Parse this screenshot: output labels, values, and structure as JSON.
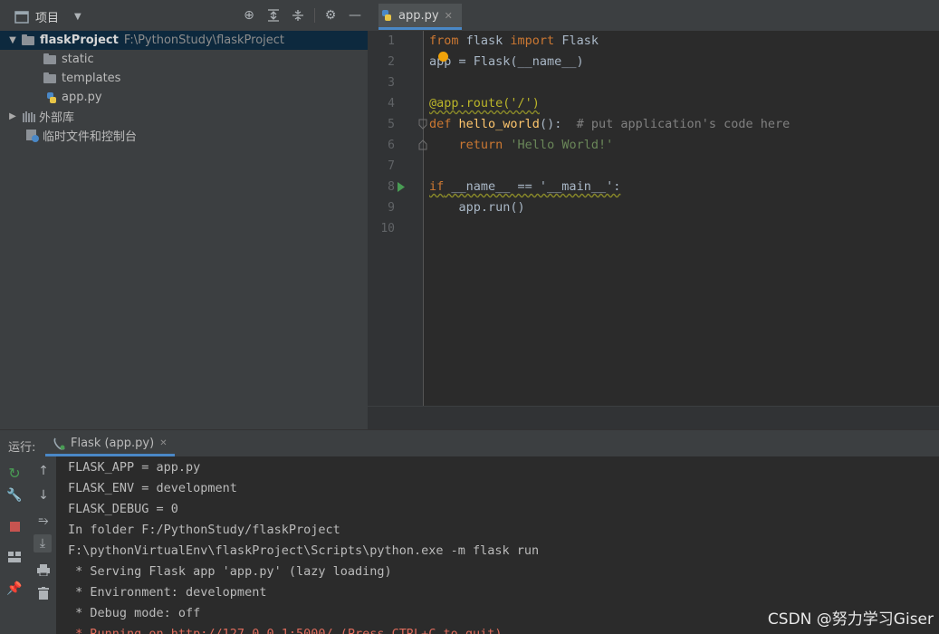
{
  "project_panel": {
    "title": "项目",
    "tree": {
      "root_name": "flaskProject",
      "root_path": "F:\\PythonStudy\\flaskProject",
      "children": [
        "static",
        "templates",
        "app.py"
      ],
      "external_libraries": "外部库",
      "scratches": "临时文件和控制台"
    }
  },
  "editor": {
    "tab_label": "app.py",
    "line_numbers": [
      "1",
      "2",
      "3",
      "4",
      "5",
      "6",
      "7",
      "8",
      "9",
      "10"
    ],
    "code": {
      "l1_from": "from",
      "l1_mod": " flask ",
      "l1_import": "import",
      "l1_name": " Flask",
      "l2": "app = Flask(__name__)",
      "l4_deco": "@app.route('/')",
      "l5_def": "def",
      "l5_fn": " hello_world",
      "l5_paren": "():  ",
      "l5_comment": "# put application's code here",
      "l6_indent": "    ",
      "l6_return": "return",
      "l6_str": " 'Hello World!'",
      "l8_if": "if",
      "l8_rest": " __name__ == '__main__':",
      "l9": "    app.run()"
    }
  },
  "run_panel": {
    "label": "运行:",
    "tab_label": "Flask (app.py)",
    "console_lines": [
      "FLASK_APP = app.py",
      "FLASK_ENV = development",
      "FLASK_DEBUG = 0",
      "In folder F:/PythonStudy/flaskProject",
      "F:\\pythonVirtualEnv\\flaskProject\\Scripts\\python.exe -m flask run",
      " * Serving Flask app 'app.py' (lazy loading)",
      " * Environment: development",
      " * Debug mode: off",
      " * Running on http://127.0.0.1:5000/ (Press CTRL+C to quit)"
    ]
  },
  "watermark": "CSDN @努力学习Giser",
  "colors": {
    "panel_bg": "#3c3f41",
    "editor_bg": "#2b2b2b",
    "selection": "#0d293e",
    "keyword": "#cc7832",
    "string": "#6a8759",
    "function": "#ffc66d",
    "accent": "#4a88c7"
  }
}
